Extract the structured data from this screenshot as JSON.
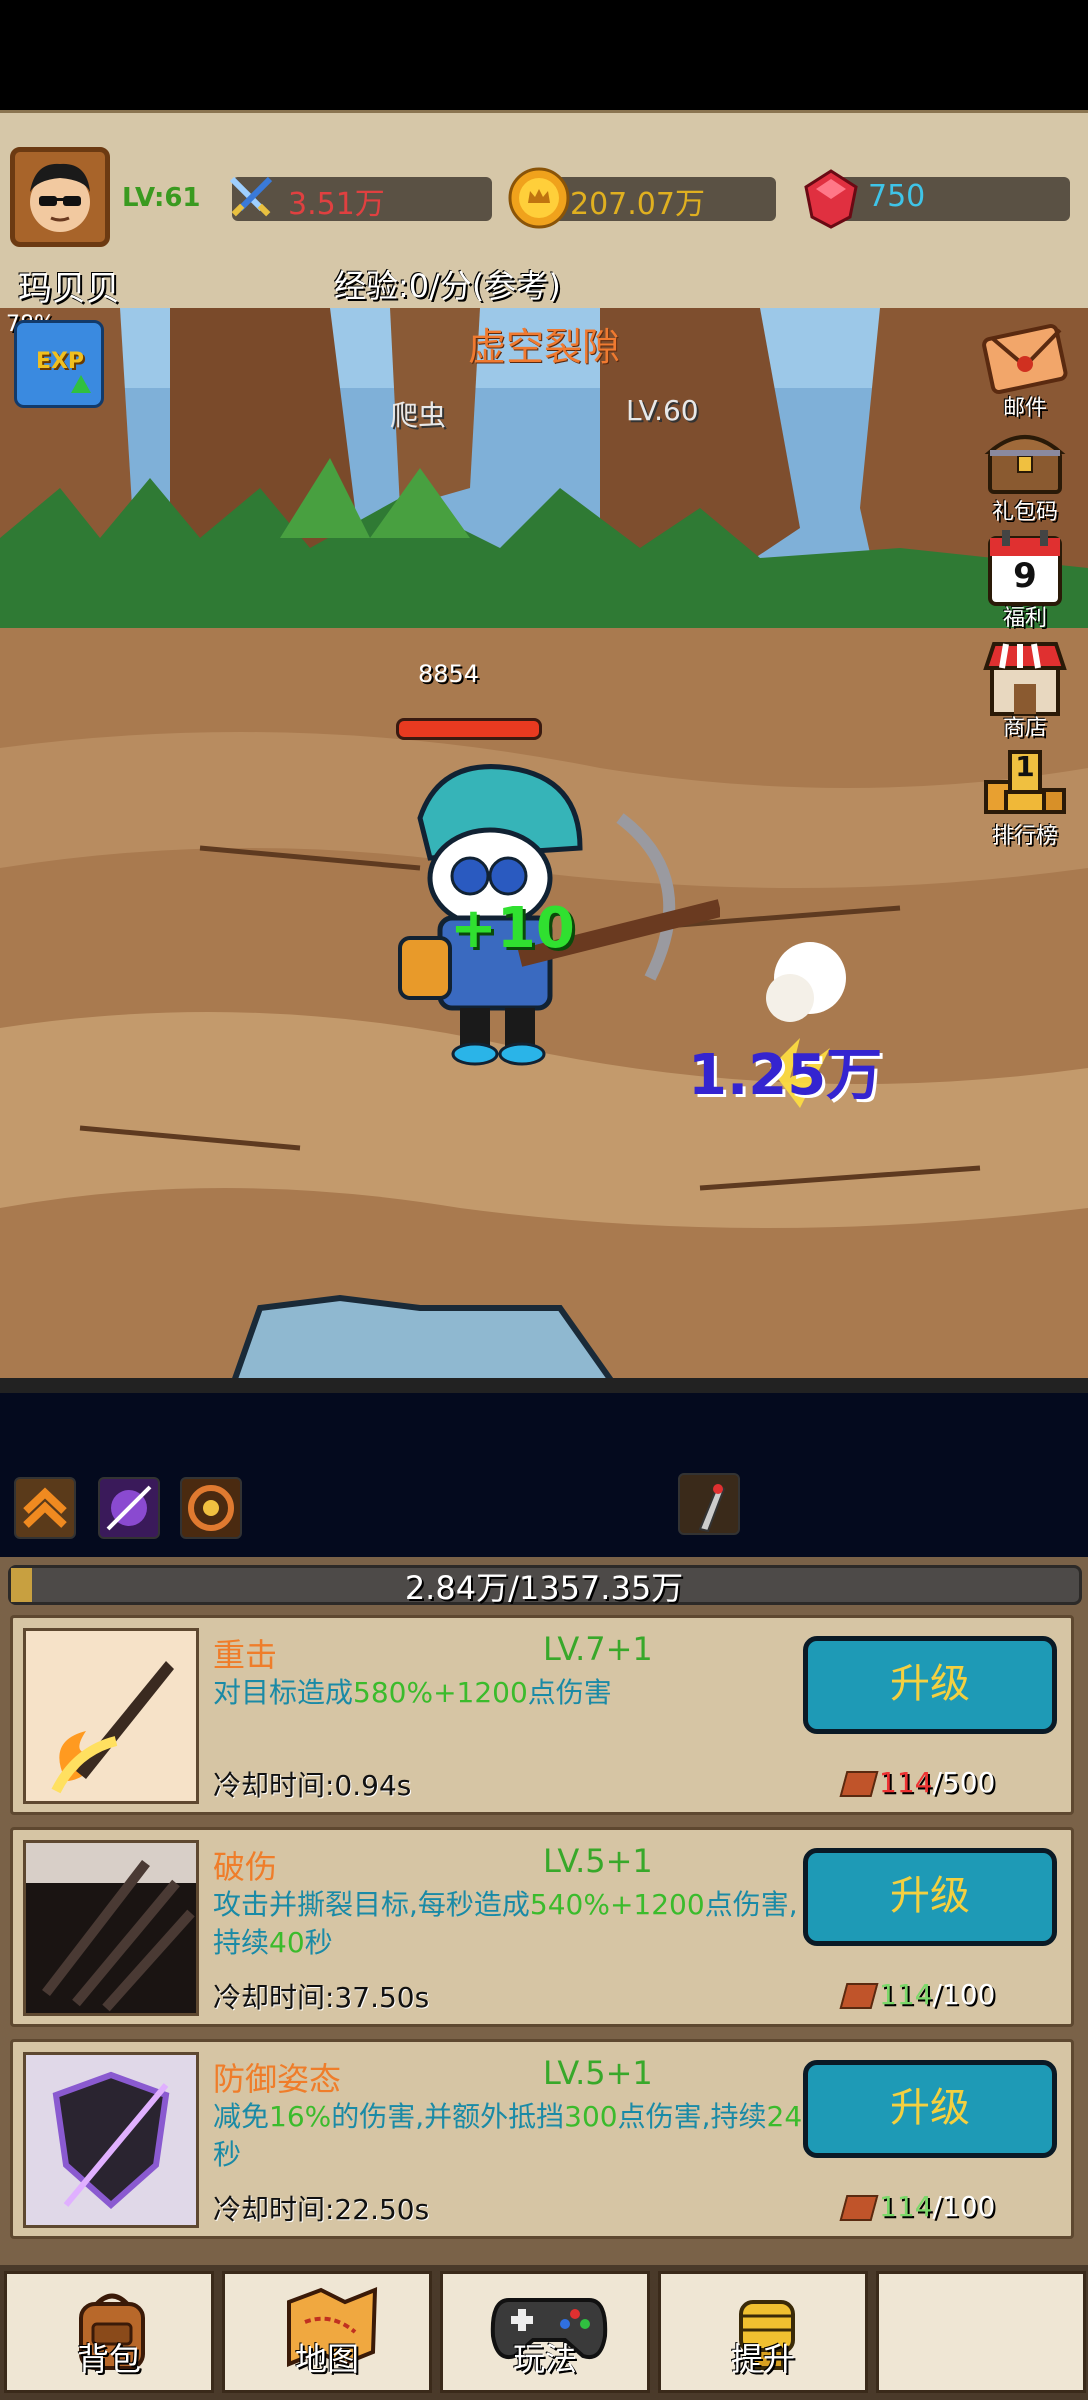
{
  "player": {
    "name": "玛贝贝",
    "level": "LV:61",
    "exp_rate": "经验:0/分(参考)"
  },
  "resources": {
    "power": "3.51万",
    "gold": "207.07万",
    "gems": "750"
  },
  "stage": {
    "title": "虚空裂隙",
    "enemy_name": "爬虫",
    "enemy_level": "LV.60",
    "enemy_hp": "8854",
    "heal_popup": "+10",
    "damage_popup": "1.25万",
    "exp_boost_percent": "78%",
    "exp_badge_text": "EXP"
  },
  "side_menu": [
    {
      "label": "邮件",
      "icon": "mail-icon"
    },
    {
      "label": "礼包码",
      "icon": "treasure-chest-icon"
    },
    {
      "label": "福利",
      "icon": "calendar-icon",
      "badge": "9"
    },
    {
      "label": "商店",
      "icon": "shop-icon"
    },
    {
      "label": "排行榜",
      "icon": "trophy-icon",
      "badge": "1"
    }
  ],
  "progress": {
    "text": "2.84万/1357.35万"
  },
  "skills": [
    {
      "name": "重击",
      "level": "LV.7+1",
      "desc_parts": [
        "对目标造成",
        "580%+1200",
        "点伤害"
      ],
      "cooldown": "冷却时间:0.94s",
      "button": "升级",
      "cost_have": "114",
      "cost_need": "/500",
      "affordable": false
    },
    {
      "name": "破伤",
      "level": "LV.5+1",
      "desc_parts": [
        "攻击并撕裂目标,每秒造成",
        "540%+1200",
        "点伤害,持续",
        "40",
        "秒"
      ],
      "cooldown": "冷却时间:37.50s",
      "button": "升级",
      "cost_have": "114",
      "cost_need": "/100",
      "affordable": true
    },
    {
      "name": "防御姿态",
      "level": "LV.5+1",
      "desc_parts": [
        "减免",
        "16%",
        "的伤害,并额外抵挡",
        "300",
        "点伤害,持续",
        "24",
        "秒"
      ],
      "cooldown": "冷却时间:22.50s",
      "button": "升级",
      "cost_have": "114",
      "cost_need": "/100",
      "affordable": true
    }
  ],
  "bottom_nav": [
    {
      "label": "背包",
      "icon": "backpack-icon"
    },
    {
      "label": "地图",
      "icon": "map-icon"
    },
    {
      "label": "玩法",
      "icon": "gamepad-icon"
    },
    {
      "label": "提升",
      "icon": "fist-icon"
    },
    {
      "label": "",
      "icon": ""
    }
  ],
  "colors": {
    "accent": "#1e9ab6",
    "gold_text": "#f4d040",
    "skill_name": "#ef7d2a",
    "level_green": "#38a82a",
    "desc_blue": "#1a8aa6"
  }
}
